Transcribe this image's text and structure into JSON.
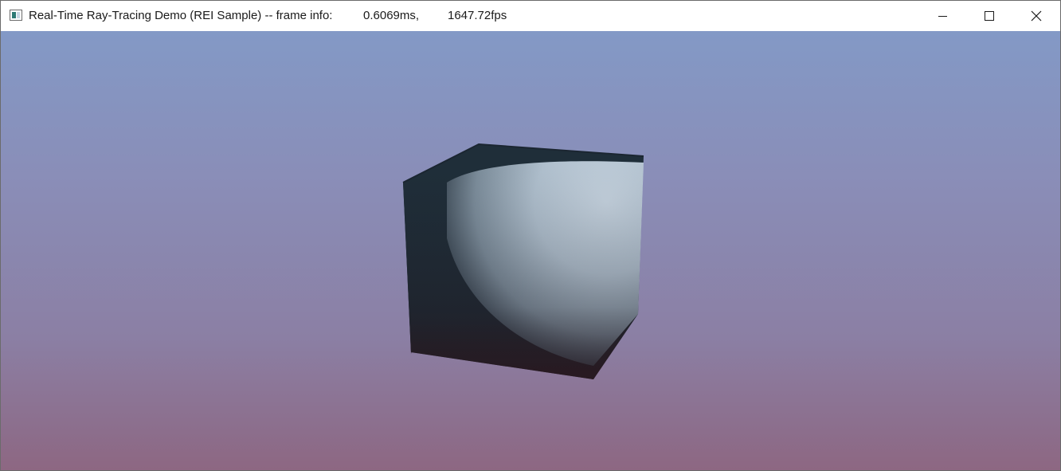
{
  "window": {
    "title_main": "Real-Time Ray-Tracing Demo (REI Sample) -- frame info:",
    "frame_time": "0.6069ms,",
    "fps": "1647.72fps"
  },
  "controls": {
    "minimize_icon": "minimize-icon",
    "maximize_icon": "maximize-icon",
    "close_icon": "close-icon"
  },
  "scene": {
    "object": "cube",
    "sky_top_color": "#8399c6",
    "sky_bottom_color": "#8d6782",
    "cube_dark_color": "#1f2d38",
    "highlight_color": "#c8d6e2"
  }
}
